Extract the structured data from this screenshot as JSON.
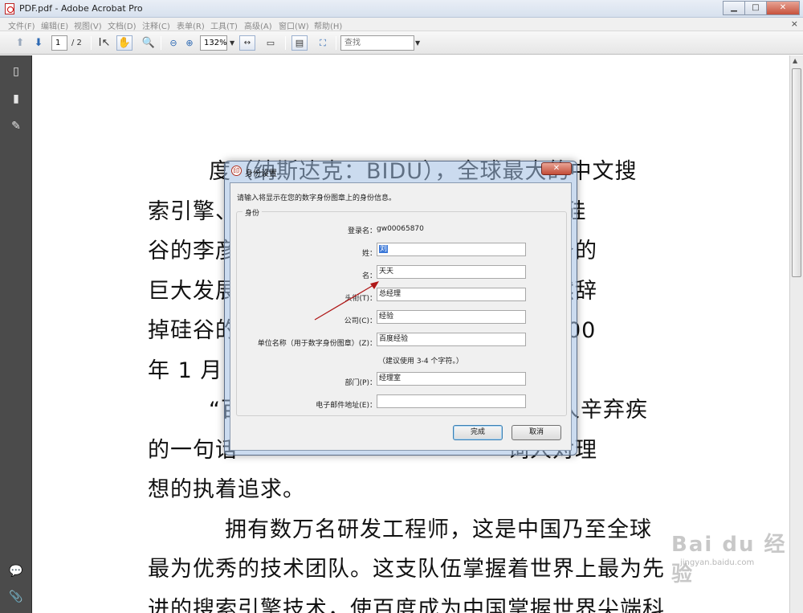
{
  "window": {
    "title": "PDF.pdf - Adobe Acrobat Pro",
    "buttons": [
      "minimize-icon",
      "maximize-icon",
      "close-icon"
    ]
  },
  "menubar": {
    "items": [
      "文件(F)",
      "编辑(E)",
      "视图(V)",
      "文档(D)",
      "注释(C)",
      "表单(R)",
      "工具(T)",
      "高级(A)",
      "窗口(W)",
      "帮助(H)"
    ],
    "close_symbol": "×"
  },
  "toolbar": {
    "page_current": "1",
    "page_total": "/ 2",
    "zoom": "132%",
    "search_placeholder": "查找"
  },
  "document": {
    "lines": [
      "度（纳斯达克：BIDU），全球最大的中文搜",
      "索引擎、　　　　　　　　　　　　在美国硅",
      "谷的李彦　　　　　　　　　　　　擎服务的",
      "巨大发展　　　　　　　　　　　　他毅然辞",
      "掉硅谷的　　　　　　　　　　　　于 2000",
      "年 1 月",
      "“百　　　　　　　　　　　　　　人辛弃疾",
      "的一句话　　　　　　　　　　　　词人对理",
      "想的执着追求。",
      "拥有数万名研发工程师，这是中国乃至全球",
      "最为优秀的技术团队。这支队伍掌握着世界上最为先",
      "进的搜索引擎技术，使百度成为中国掌握世界尖端科"
    ],
    "watermark_logo": "Bai du 经验",
    "watermark_url": "jingyan.baidu.com"
  },
  "dialog": {
    "title": "身份设置",
    "close_symbol": "✕",
    "instruction": "请输入将显示在您的数字身份图章上的身份信息。",
    "group_label": "身份",
    "login_label": "登录名：",
    "login_value": "gw00065870",
    "surname_label": "姓：",
    "surname_value": "刘",
    "givenname_label": "名：",
    "givenname_value": "天天",
    "title_label": "头衔(T)：",
    "title_value": "总经理",
    "company_label": "公司(C)：",
    "company_value": "经验",
    "unit_label": "单位名称（用于数字身份图章）(Z)：",
    "unit_value": "百度经验",
    "unit_hint": "（建议使用 3-4 个字符。）",
    "dept_label": "部门(P)：",
    "dept_value": "经理室",
    "email_label": "电子邮件地址(E)：",
    "email_value": "",
    "ok_label": "完成",
    "cancel_label": "取消"
  },
  "colors": {
    "accent": "#3b78d8",
    "annotation_arrow": "#b01818",
    "nav_panel": "#4b4b4b"
  }
}
